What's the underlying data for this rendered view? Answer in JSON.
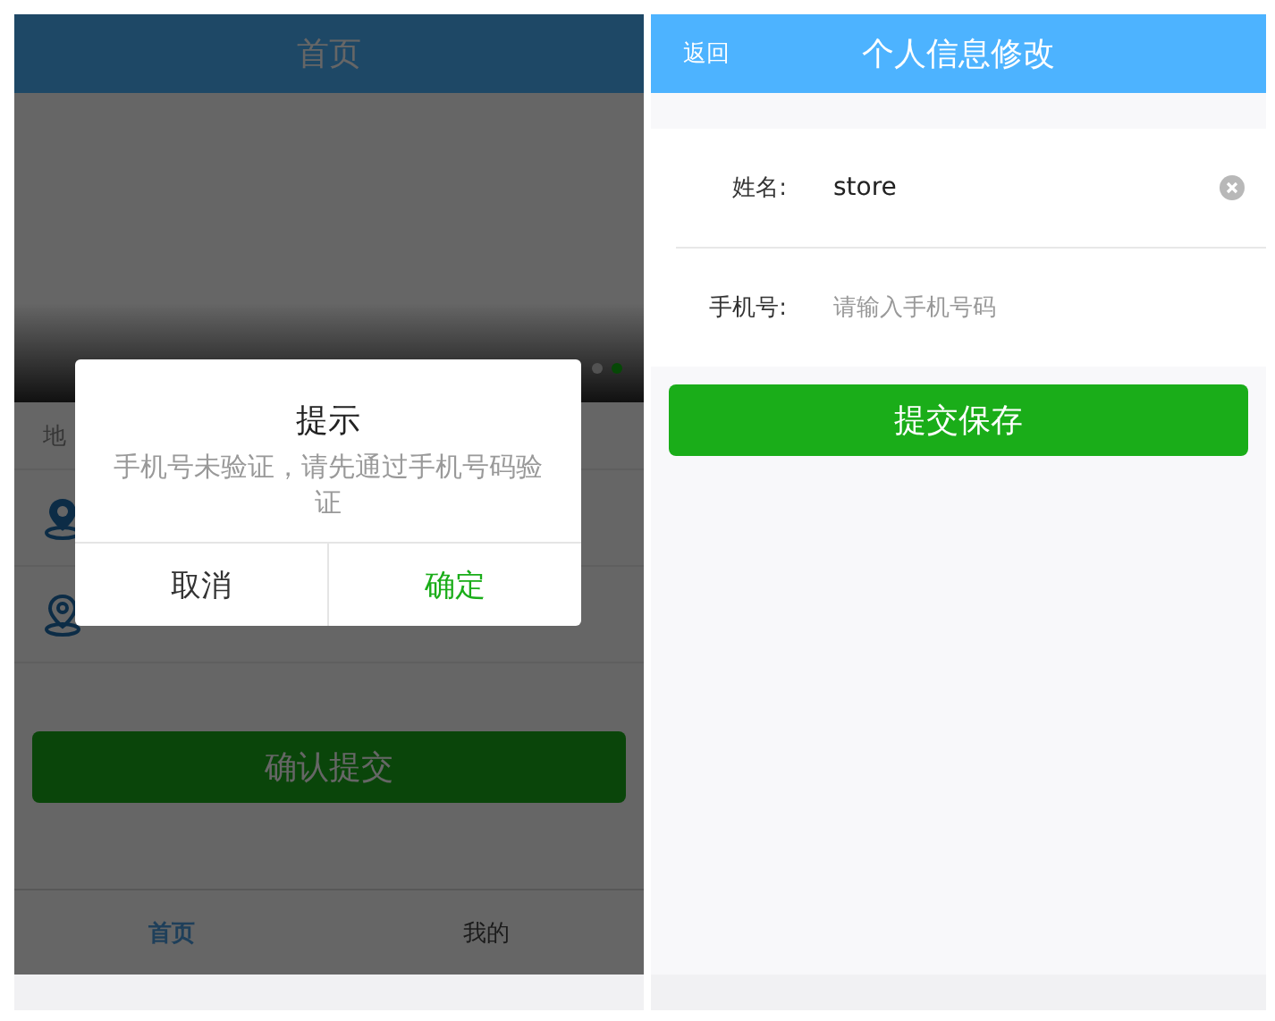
{
  "left_screen": {
    "header": {
      "title": "首页"
    },
    "banner": {
      "dots": [
        {
          "selected": false
        },
        {
          "selected": true
        }
      ]
    },
    "location_label": "地",
    "location_rows": [
      {
        "kind": "filled"
      },
      {
        "kind": "outline"
      }
    ],
    "submit_button": "确认提交",
    "tabs": [
      {
        "label": "首页",
        "selected": true
      },
      {
        "label": "我的",
        "selected": false
      }
    ],
    "dialog": {
      "title": "提示",
      "message": "手机号未验证，请先通过手机号码验证",
      "buttons": [
        {
          "label": "取消",
          "kind": "cancel"
        },
        {
          "label": "确定",
          "kind": "confirm"
        }
      ]
    }
  },
  "right_screen": {
    "header": {
      "back": "返回",
      "title": "个人信息修改"
    },
    "fields": [
      {
        "label": "姓名:",
        "value": "store",
        "clearable": true
      },
      {
        "label": "手机号:",
        "placeholder": "请输入手机号码"
      }
    ],
    "submit_button": "提交保存"
  }
}
